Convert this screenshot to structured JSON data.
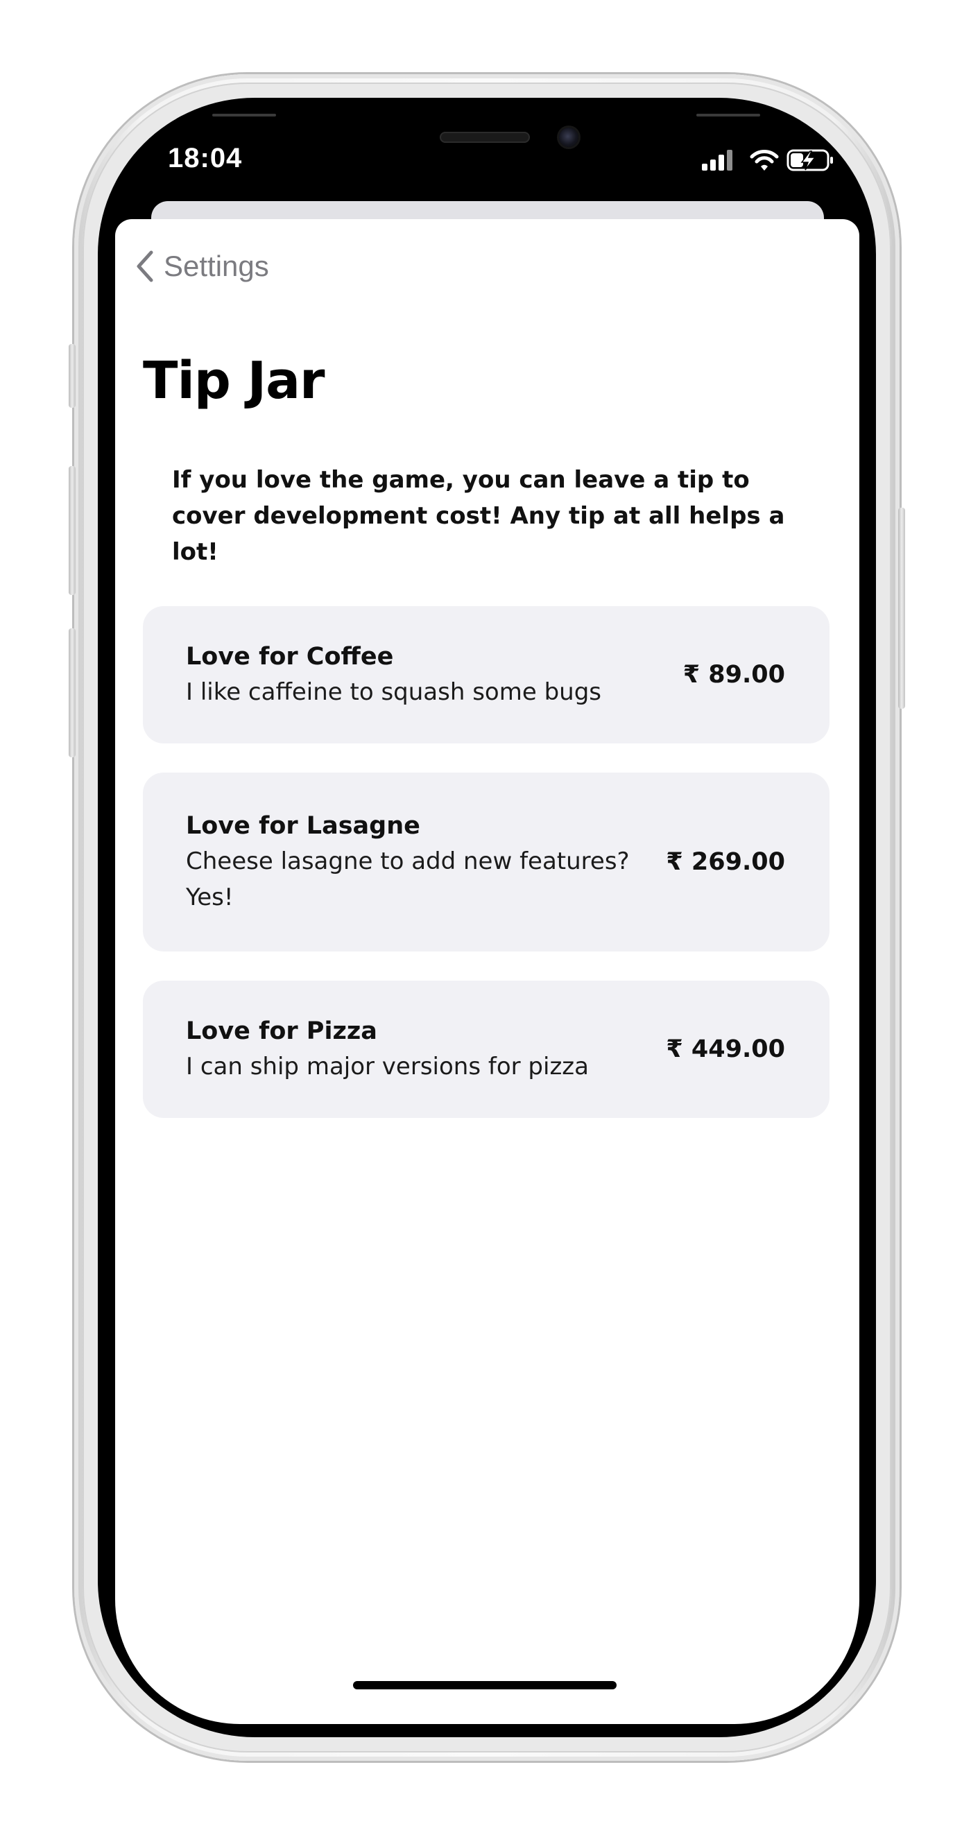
{
  "status_bar": {
    "time": "18:04",
    "icons": [
      "cellular-signal-icon",
      "wifi-icon",
      "battery-charging-icon"
    ]
  },
  "nav": {
    "back_label": "Settings"
  },
  "page": {
    "title": "Tip Jar",
    "intro": "If you love the game, you can leave a tip to cover development cost! Any tip at all helps a lot!"
  },
  "tips": [
    {
      "name": "Love for Coffee",
      "description": "I like caffeine to squash some bugs",
      "price": "₹ 89.00"
    },
    {
      "name": "Love for Lasagne",
      "description": "Cheese lasagne to add new features? Yes!",
      "price": "₹ 269.00"
    },
    {
      "name": "Love for Pizza",
      "description": "I can ship major versions for pizza",
      "price": "₹ 449.00"
    }
  ],
  "colors": {
    "card_background": "#f1f1f5",
    "back_link": "#7b7b80",
    "text": "#111111"
  }
}
